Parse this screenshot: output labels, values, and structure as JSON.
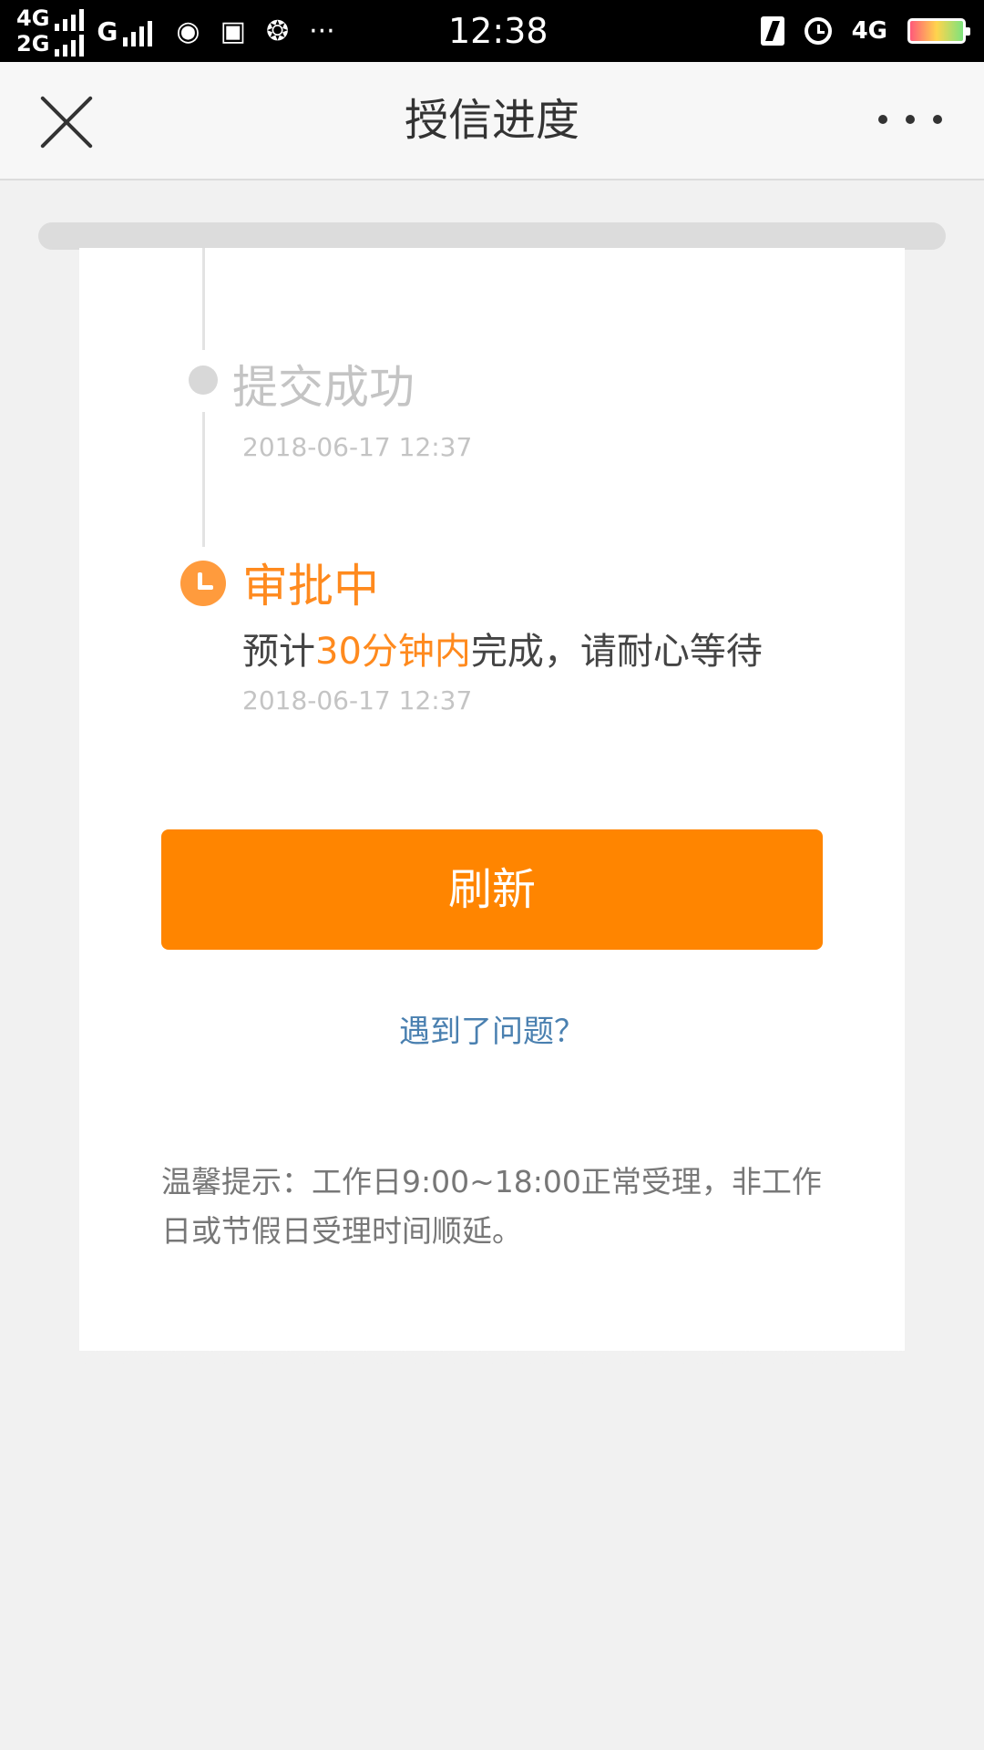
{
  "status_bar": {
    "network_1": "4G",
    "network_2": "2G",
    "network_3": "G",
    "time": "12:38",
    "network_4": "4G",
    "icons": [
      "weibo-icon",
      "shopping-bag-icon",
      "wechat-icon",
      "more-notifications-icon",
      "charging-icon",
      "alarm-icon",
      "battery-icon"
    ]
  },
  "nav": {
    "title": "授信进度"
  },
  "steps": [
    {
      "title": "提交成功",
      "time": "2018-06-17 12:37",
      "status": "done"
    },
    {
      "title": "审批中",
      "desc_prefix": "预计",
      "desc_highlight": "30分钟内",
      "desc_suffix": "完成，请耐心等待",
      "time": "2018-06-17 12:37",
      "status": "active"
    }
  ],
  "actions": {
    "refresh_label": "刷新",
    "problem_link": "遇到了问题？"
  },
  "tip": "温馨提示：工作日9:00~18:00正常受理，非工作日或节假日受理时间顺延。",
  "colors": {
    "accent": "#ff8500",
    "highlight_text": "#ff8a1e",
    "link": "#4a80b0",
    "muted": "#c4c4c4"
  }
}
